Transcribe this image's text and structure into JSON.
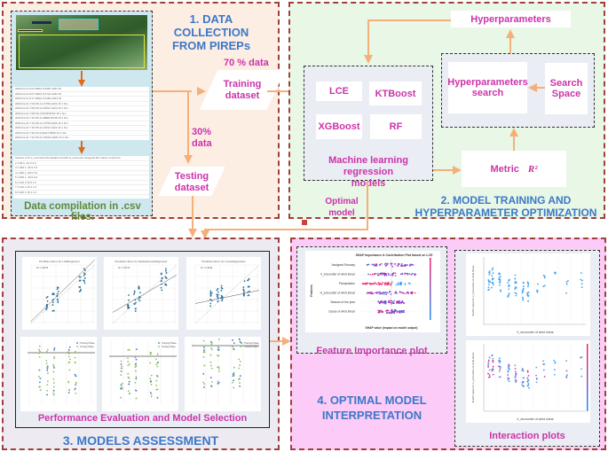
{
  "sections": {
    "s1_title": "1. DATA COLLECTION FROM PIREPs",
    "s2_title_line1": "2. MODEL TRAINING AND",
    "s2_title_line2": "HYPERPARAMETER OPTIMIZATION",
    "s3_title": "3. MODELS ASSESSMENT",
    "s4_title_line1": "4. OPTIMAL MODEL",
    "s4_title_line2": "INTERPRETATION"
  },
  "data_collection": {
    "caption": "Data compilation in .csv files.",
    "raw_table_rows": [
      [
        "2023-01-14",
        "9:01:29RA",
        "CX987",
        "A333",
        "15"
      ],
      [
        "2023-01-14",
        "9:07:29RA",
        "CX722",
        "A333",
        "15"
      ],
      [
        "2023-01-14",
        "9:17:29RA",
        "CX150",
        "A333",
        "15"
      ],
      [
        "2023-01-21",
        "7:03:07LA",
        "CX766",
        "A333",
        "15 1 Nm"
      ],
      [
        "2023-01-21",
        "7:05:07LA",
        "HX337",
        "A320",
        "15 1 Nm"
      ],
      [
        "2023-01-21",
        "7:08:07LA",
        "5K68",
        "B763",
        "15 1 Nm"
      ],
      [
        "2023-01-21",
        "7:10:07LA",
        "HB682",
        "B738",
        "15 1 Nm"
      ],
      [
        "2023-01-21",
        "7:12:07LA",
        "CX750",
        "A333",
        "10 1 Nm"
      ],
      [
        "2023-01-21",
        "7:15:07LA",
        "HX237",
        "A320",
        "10 1 Nm"
      ],
      [
        "2023-01-21",
        "7:20:07LA",
        "BA31",
        "B789",
        "10 1 Nm"
      ],
      [
        "2023-01-21",
        "7:22:07LA",
        "UO603",
        "A20N",
        "15 1 Nm"
      ]
    ],
    "processed_header": "Season of th V_encounte Precipitatio CLASS  H_encounte Assigned Ru Cause of wind sh",
    "processed_rows": [
      [
        "2",
        "1",
        "80",
        "0",
        "-15",
        "0",
        "3",
        "0"
      ],
      [
        "3",
        "1",
        "300",
        "1",
        "-30",
        "0",
        "3",
        "0"
      ],
      [
        "4",
        "1",
        "300",
        "1",
        "-60",
        "0",
        "3",
        "0"
      ],
      [
        "5",
        "2",
        "500",
        "1",
        "-20",
        "0",
        "0",
        "0"
      ],
      [
        "6",
        "2",
        "100",
        "0",
        "15",
        "0",
        "1",
        "0"
      ],
      [
        "7",
        "2",
        "100",
        "1",
        "20",
        "1",
        "1",
        "0"
      ],
      [
        "8",
        "2",
        "200",
        "1",
        "15",
        "1",
        "1",
        "0"
      ]
    ]
  },
  "split": {
    "train_pct": "70 % data",
    "train_label_1": "Training",
    "train_label_2": "dataset",
    "test_pct_1": "30%",
    "test_pct_2": "data",
    "test_label_1": "Testing",
    "test_label_2": "dataset"
  },
  "training": {
    "models": [
      "LCE",
      "KTBoost",
      "XGBoost",
      "RF"
    ],
    "models_caption_1": "Machine learning regression",
    "models_caption_2": "models",
    "hyperparameters": "Hyperparameters",
    "hp_search_1": "Hyperparameters",
    "hp_search_2": "search",
    "search_space_1": "Search",
    "search_space_2": "Space",
    "metric": "Metric",
    "metric_symbol": "R²",
    "optimal_1": "Optimal",
    "optimal_2": "model"
  },
  "assessment": {
    "caption": "Performance Evaluation and Model Selection",
    "plot_titles": [
      "Prediction Error for LCERegressor",
      "Prediction Error for StackedLinearRegressor",
      "Prediction Error for LinearRegression"
    ],
    "legend_pred": [
      "R² = 0.9275",
      "R² = 0.8770",
      "R² = 0.4198"
    ],
    "legend_fit": "best fit",
    "legend_identity": "identity",
    "residual_legend": [
      "Training Phase",
      "Testing Phase"
    ]
  },
  "interpretation": {
    "feature_caption": "Feature Importance plot",
    "shap_title": "SHAP Importance & Contribution Plot based on LCE",
    "shap_features": [
      "Assigned Runway",
      "V_encounter of wind shear",
      "Precipitation",
      "H_encounter of wind shear",
      "Season of the year",
      "Cause of wind shear"
    ],
    "shap_xlabel": "SHAP value (impact on model output)",
    "shap_ylabel": "Features",
    "shap_colorbar_high": "High",
    "shap_colorbar_low": "Low",
    "shap_colorbar_label": "Feature value",
    "interaction_caption": "Interaction plots",
    "dep_xlabel": "V_encounter of wind shear",
    "dep_ylabel": "SHAP value for V_encounter of wind shear",
    "dep_colorbar_label": "Assigned Runway"
  }
}
